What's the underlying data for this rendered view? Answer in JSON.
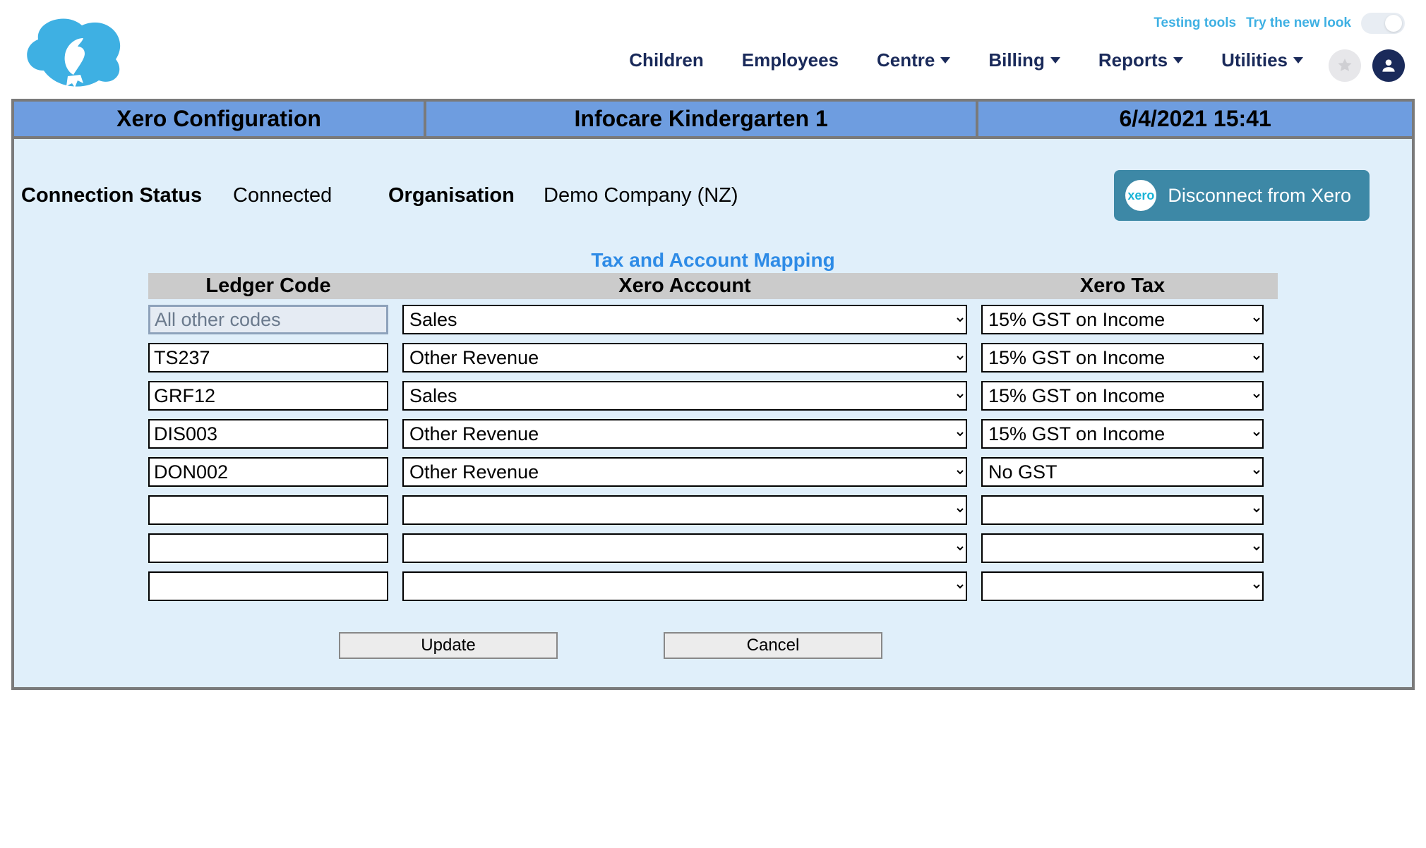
{
  "top": {
    "testing_tools": "Testing tools",
    "try_new_look": "Try the new look"
  },
  "nav": {
    "children": "Children",
    "employees": "Employees",
    "centre": "Centre",
    "billing": "Billing",
    "reports": "Reports",
    "utilities": "Utilities"
  },
  "titlebar": {
    "left": "Xero Configuration",
    "center": "Infocare Kindergarten 1",
    "right": "6/4/2021 15:41"
  },
  "status": {
    "connection_label": "Connection Status",
    "connection_value": "Connected",
    "organisation_label": "Organisation",
    "organisation_value": "Demo Company (NZ)",
    "disconnect": "Disconnect from Xero",
    "xero_badge": "xero"
  },
  "mapping": {
    "title": "Tax and Account Mapping",
    "headers": {
      "ledger": "Ledger Code",
      "account": "Xero Account",
      "tax": "Xero Tax"
    },
    "rows": [
      {
        "ledger": "All other codes",
        "ledger_disabled": true,
        "account": "Sales",
        "tax": "15% GST on Income"
      },
      {
        "ledger": "TS237",
        "ledger_disabled": false,
        "account": "Other Revenue",
        "tax": "15% GST on Income"
      },
      {
        "ledger": "GRF12",
        "ledger_disabled": false,
        "account": "Sales",
        "tax": "15% GST on Income"
      },
      {
        "ledger": "DIS003",
        "ledger_disabled": false,
        "account": "Other Revenue",
        "tax": "15% GST on Income"
      },
      {
        "ledger": "DON002",
        "ledger_disabled": false,
        "account": "Other Revenue",
        "tax": "No GST"
      },
      {
        "ledger": "",
        "ledger_disabled": false,
        "account": "",
        "tax": ""
      },
      {
        "ledger": "",
        "ledger_disabled": false,
        "account": "",
        "tax": ""
      },
      {
        "ledger": "",
        "ledger_disabled": false,
        "account": "",
        "tax": ""
      }
    ],
    "account_options": [
      "",
      "Sales",
      "Other Revenue"
    ],
    "tax_options": [
      "",
      "15% GST on Income",
      "No GST"
    ]
  },
  "buttons": {
    "update": "Update",
    "cancel": "Cancel"
  }
}
